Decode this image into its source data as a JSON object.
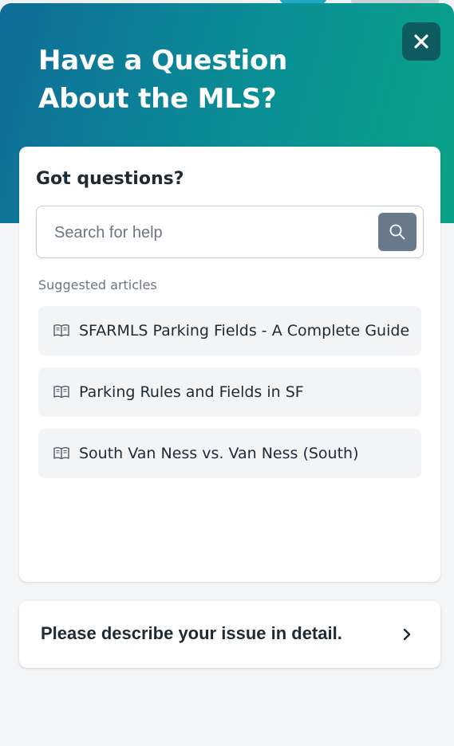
{
  "header": {
    "title": "Have a Question About the MLS?"
  },
  "card": {
    "title": "Got questions?",
    "search": {
      "placeholder": "Search for help",
      "value": ""
    },
    "suggested_label": "Suggested articles",
    "articles": [
      {
        "label": "SFARMLS Parking Fields - A Complete Guide",
        "icon": "book-icon"
      },
      {
        "label": "Parking Rules and Fields in SF",
        "icon": "book-icon"
      },
      {
        "label": "South Van Ness vs. Van Ness (South)",
        "icon": "book-icon"
      }
    ]
  },
  "describe": {
    "label": "Please describe your issue in detail."
  },
  "colors": {
    "header_gradient_start": "#0f6d99",
    "header_gradient_end": "#09a387",
    "close_button": "#0d5b5f",
    "search_button": "#687a8c",
    "text_primary": "#1d2b36",
    "text_muted": "#6b7680",
    "article_bg": "#f2f4f6",
    "panel_bg": "#f3f5f7"
  }
}
